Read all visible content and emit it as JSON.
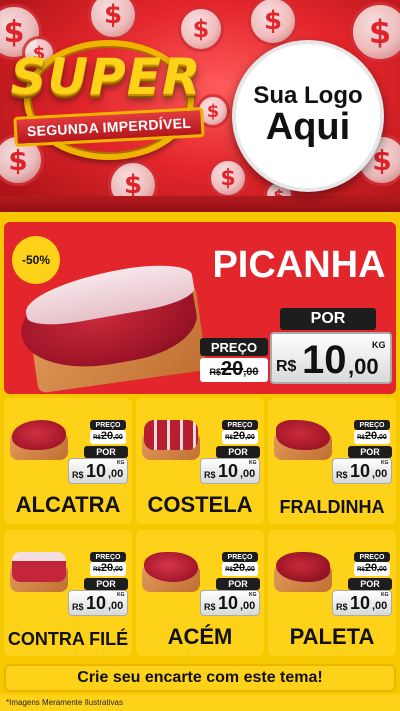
{
  "header": {
    "brand": "SUPER",
    "ribbon": "SEGUNDA IMPERDÍVEL",
    "logo_line1": "Sua Logo",
    "logo_line2": "Aqui",
    "coin_symbol": "$"
  },
  "featured": {
    "badge": "-50%",
    "name": "PICANHA",
    "old_label": "PREÇO",
    "old_currency": "R$",
    "old_int": "20",
    "old_dec": ",00",
    "new_label": "POR",
    "new_currency": "R$",
    "new_int": "10",
    "new_dec": ",00",
    "unit": "KG"
  },
  "products": [
    {
      "name": "ALCATRA",
      "old_label": "PREÇO",
      "old_currency": "R$",
      "old_int": "20",
      "old_dec": ",00",
      "new_label": "POR",
      "new_currency": "R$",
      "new_int": "10",
      "new_dec": ",00",
      "unit": "KG"
    },
    {
      "name": "COSTELA",
      "old_label": "PREÇO",
      "old_currency": "R$",
      "old_int": "20",
      "old_dec": ",00",
      "new_label": "POR",
      "new_currency": "R$",
      "new_int": "10",
      "new_dec": ",00",
      "unit": "KG"
    },
    {
      "name": "FRALDINHA",
      "old_label": "PREÇO",
      "old_currency": "R$",
      "old_int": "20",
      "old_dec": ",00",
      "new_label": "POR",
      "new_currency": "R$",
      "new_int": "10",
      "new_dec": ",00",
      "unit": "KG"
    },
    {
      "name": "CONTRA FILÉ",
      "old_label": "PREÇO",
      "old_currency": "R$",
      "old_int": "20",
      "old_dec": ",00",
      "new_label": "POR",
      "new_currency": "R$",
      "new_int": "10",
      "new_dec": ",00",
      "unit": "KG"
    },
    {
      "name": "ACÉM",
      "old_label": "PREÇO",
      "old_currency": "R$",
      "old_int": "20",
      "old_dec": ",00",
      "new_label": "POR",
      "new_currency": "R$",
      "new_int": "10",
      "new_dec": ",00",
      "unit": "KG"
    },
    {
      "name": "PALETA",
      "old_label": "PREÇO",
      "old_currency": "R$",
      "old_int": "20",
      "old_dec": ",00",
      "new_label": "POR",
      "new_currency": "R$",
      "new_int": "10",
      "new_dec": ",00",
      "unit": "KG"
    }
  ],
  "footer": {
    "cta": "Crie seu encarte com este tema!",
    "disclaimer": "*Imagens Meramente Ilustrativas"
  },
  "colors": {
    "red": "#e3262b",
    "yellow": "#ffd21a",
    "dark": "#1d1d1d"
  }
}
